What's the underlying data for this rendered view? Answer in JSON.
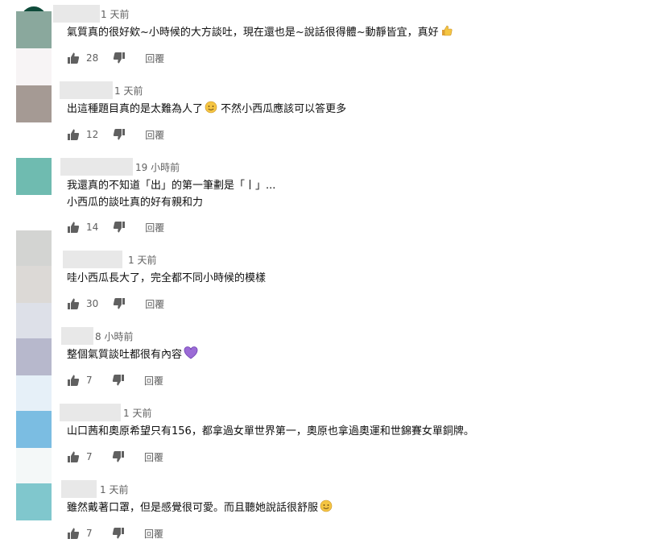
{
  "reply_label": "回覆",
  "comments": [
    {
      "time": "1 天前",
      "lines": [
        "氣質真的很好欸~小時候的大方談吐，現在還也是~說話很得體~動靜皆宜，真好"
      ],
      "emoji": "thumbs-up",
      "likes": "28"
    },
    {
      "time": "1 天前",
      "lines": [
        "出這種題目真的是太難為人了",
        " 不然小西瓜應該可以答更多"
      ],
      "emoji": "smile-inline",
      "likes": "12"
    },
    {
      "time": "19 小時前",
      "lines": [
        "我還真的不知道「出」的第一筆劃是「丨」...",
        "小西瓜的談吐真的好有親和力"
      ],
      "likes": "14"
    },
    {
      "time": "1 天前",
      "lines": [
        "哇小西瓜長大了，完全都不同小時候的模樣"
      ],
      "likes": "30"
    },
    {
      "time": "8 小時前",
      "lines": [
        "整個氣質談吐都很有內容"
      ],
      "emoji": "purple-heart",
      "likes": "7"
    },
    {
      "time": "1 天前",
      "lines": [
        "山口茜和奧原希望只有156，都拿過女單世界第一，奧原也拿過奧運和世錦賽女單銅牌。"
      ],
      "likes": "7"
    },
    {
      "time": "1 天前",
      "lines": [
        "雖然戴著口罩，但是感覺很可愛。而且聽她說話很舒服"
      ],
      "emoji": "smile",
      "likes": "7"
    }
  ],
  "colors": {
    "avatars": [
      "#8aa89d",
      "#f7f4f5",
      "#a59a94",
      "#ffffff",
      "#6fbbb0",
      "#ffffff",
      "#d3d4d2",
      "#dcd9d6",
      "#dde0e8",
      "#b7b8cc",
      "#e6f0f8",
      "#7bbde2",
      "#f4f8f8",
      "#80c7cd"
    ]
  }
}
